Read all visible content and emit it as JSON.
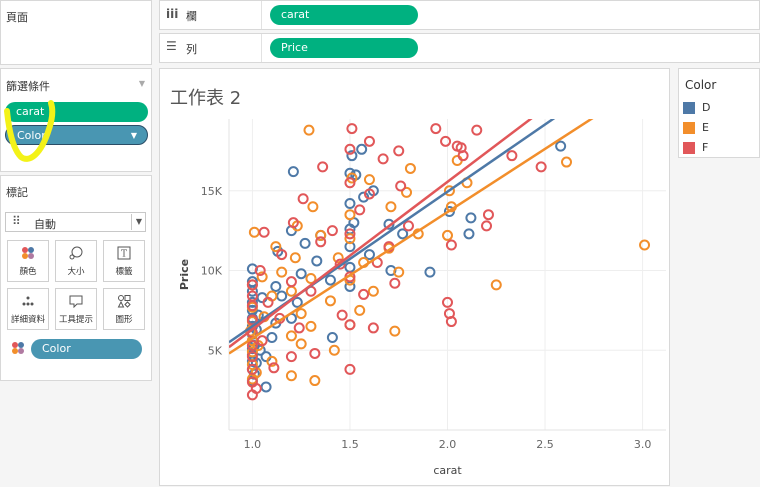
{
  "pages": {
    "title": "頁面"
  },
  "shelves": {
    "columns": {
      "icon": "iii",
      "label": "欄",
      "pill": "carat"
    },
    "rows": {
      "icon": "☰",
      "label": "列",
      "pill": "Price"
    }
  },
  "filters": {
    "title": "篩選條件",
    "items": [
      "carat",
      "Color"
    ]
  },
  "marks": {
    "title": "標記",
    "mark_type": "自動",
    "buttons": [
      {
        "label": "顏色",
        "icon": "color-icon"
      },
      {
        "label": "大小",
        "icon": "size-icon"
      },
      {
        "label": "標籤",
        "icon": "label-icon"
      },
      {
        "label": "詳細資料",
        "icon": "detail-icon"
      },
      {
        "label": "工具提示",
        "icon": "tooltip-icon"
      },
      {
        "label": "圖形",
        "icon": "shape-icon"
      }
    ],
    "color_pill": "Color"
  },
  "sheet": {
    "title": "工作表 2"
  },
  "legend": {
    "title": "Color",
    "items": [
      {
        "label": "D",
        "color": "#4e79a7"
      },
      {
        "label": "E",
        "color": "#f28e2b"
      },
      {
        "label": "F",
        "color": "#e15759"
      }
    ]
  },
  "chart_data": {
    "type": "scatter",
    "title": "",
    "xlabel": "carat",
    "ylabel": "Price",
    "xlim": [
      0.88,
      3.12
    ],
    "ylim": [
      0,
      19500
    ],
    "x_ticks": [
      "1.0",
      "1.5",
      "2.0",
      "2.5",
      "3.0"
    ],
    "y_ticks": [
      "5K",
      "10K",
      "15K"
    ],
    "grid": true,
    "legend_position": "right",
    "marker": "hollow-circle",
    "series": [
      {
        "name": "D",
        "color": "#4e79a7",
        "points": [
          [
            1.0,
            3100
          ],
          [
            1.0,
            3800
          ],
          [
            1.0,
            4300
          ],
          [
            1.0,
            4700
          ],
          [
            1.0,
            5100
          ],
          [
            1.0,
            5600
          ],
          [
            1.0,
            6000
          ],
          [
            1.0,
            6500
          ],
          [
            1.0,
            7000
          ],
          [
            1.0,
            7500
          ],
          [
            1.0,
            8000
          ],
          [
            1.0,
            8700
          ],
          [
            1.0,
            9300
          ],
          [
            1.0,
            10100
          ],
          [
            1.01,
            3500
          ],
          [
            1.01,
            5300
          ],
          [
            1.02,
            4200
          ],
          [
            1.02,
            6300
          ],
          [
            1.03,
            7200
          ],
          [
            1.04,
            5000
          ],
          [
            1.05,
            8300
          ],
          [
            1.07,
            4600
          ],
          [
            1.07,
            2700
          ],
          [
            1.1,
            5800
          ],
          [
            1.12,
            6700
          ],
          [
            1.12,
            9000
          ],
          [
            1.13,
            11200
          ],
          [
            1.15,
            8400
          ],
          [
            1.2,
            7000
          ],
          [
            1.2,
            12500
          ],
          [
            1.21,
            16200
          ],
          [
            1.23,
            8000
          ],
          [
            1.25,
            9800
          ],
          [
            1.27,
            11700
          ],
          [
            1.33,
            10600
          ],
          [
            1.35,
            12200
          ],
          [
            1.4,
            9400
          ],
          [
            1.41,
            5800
          ],
          [
            1.5,
            9000
          ],
          [
            1.5,
            10200
          ],
          [
            1.5,
            11500
          ],
          [
            1.5,
            12600
          ],
          [
            1.5,
            14200
          ],
          [
            1.5,
            16100
          ],
          [
            1.51,
            17200
          ],
          [
            1.52,
            13000
          ],
          [
            1.53,
            16000
          ],
          [
            1.56,
            17600
          ],
          [
            1.57,
            14600
          ],
          [
            1.6,
            11000
          ],
          [
            1.62,
            15000
          ],
          [
            1.7,
            12900
          ],
          [
            1.71,
            10000
          ],
          [
            1.77,
            12300
          ],
          [
            1.91,
            9900
          ],
          [
            2.01,
            13700
          ],
          [
            2.11,
            12300
          ],
          [
            2.12,
            13300
          ],
          [
            2.58,
            17800
          ]
        ]
      },
      {
        "name": "E",
        "color": "#f28e2b",
        "points": [
          [
            0.99,
            6200
          ],
          [
            1.0,
            3200
          ],
          [
            1.0,
            4100
          ],
          [
            1.0,
            4900
          ],
          [
            1.0,
            5600
          ],
          [
            1.0,
            6800
          ],
          [
            1.0,
            7700
          ],
          [
            1.0,
            9100
          ],
          [
            1.01,
            12400
          ],
          [
            1.02,
            3600
          ],
          [
            1.03,
            5300
          ],
          [
            1.05,
            9600
          ],
          [
            1.06,
            7100
          ],
          [
            1.1,
            4300
          ],
          [
            1.1,
            8400
          ],
          [
            1.12,
            11500
          ],
          [
            1.15,
            9900
          ],
          [
            1.2,
            3400
          ],
          [
            1.2,
            5900
          ],
          [
            1.2,
            8700
          ],
          [
            1.22,
            10800
          ],
          [
            1.23,
            12800
          ],
          [
            1.25,
            7300
          ],
          [
            1.25,
            5400
          ],
          [
            1.3,
            6500
          ],
          [
            1.3,
            9500
          ],
          [
            1.31,
            14000
          ],
          [
            1.35,
            12200
          ],
          [
            1.4,
            8100
          ],
          [
            1.42,
            5000
          ],
          [
            1.44,
            10800
          ],
          [
            1.5,
            6600
          ],
          [
            1.5,
            9400
          ],
          [
            1.5,
            12000
          ],
          [
            1.5,
            13500
          ],
          [
            1.51,
            15800
          ],
          [
            1.55,
            7500
          ],
          [
            1.57,
            10500
          ],
          [
            1.6,
            15700
          ],
          [
            1.62,
            8700
          ],
          [
            1.7,
            11400
          ],
          [
            1.71,
            14000
          ],
          [
            1.73,
            6200
          ],
          [
            1.75,
            9900
          ],
          [
            1.79,
            14900
          ],
          [
            1.81,
            16400
          ],
          [
            1.85,
            12300
          ],
          [
            2.0,
            12200
          ],
          [
            2.01,
            15000
          ],
          [
            2.02,
            14000
          ],
          [
            2.05,
            16900
          ],
          [
            2.1,
            15500
          ],
          [
            2.25,
            9100
          ],
          [
            2.61,
            16800
          ],
          [
            3.01,
            11600
          ],
          [
            1.29,
            18800
          ],
          [
            1.32,
            3100
          ]
        ]
      },
      {
        "name": "F",
        "color": "#e15759",
        "points": [
          [
            1.0,
            2200
          ],
          [
            1.0,
            3000
          ],
          [
            1.0,
            3800
          ],
          [
            1.0,
            4600
          ],
          [
            1.0,
            5300
          ],
          [
            1.0,
            6100
          ],
          [
            1.0,
            6900
          ],
          [
            1.0,
            7800
          ],
          [
            1.0,
            8400
          ],
          [
            1.0,
            9100
          ],
          [
            1.02,
            2600
          ],
          [
            1.04,
            10000
          ],
          [
            1.05,
            5600
          ],
          [
            1.06,
            12400
          ],
          [
            1.08,
            8000
          ],
          [
            1.11,
            3900
          ],
          [
            1.14,
            7000
          ],
          [
            1.15,
            11000
          ],
          [
            1.2,
            4600
          ],
          [
            1.2,
            9300
          ],
          [
            1.21,
            13000
          ],
          [
            1.24,
            6400
          ],
          [
            1.26,
            14500
          ],
          [
            1.3,
            8700
          ],
          [
            1.32,
            4800
          ],
          [
            1.35,
            11800
          ],
          [
            1.36,
            16500
          ],
          [
            1.41,
            12500
          ],
          [
            1.45,
            10400
          ],
          [
            1.46,
            7200
          ],
          [
            1.5,
            3800
          ],
          [
            1.5,
            6600
          ],
          [
            1.5,
            9600
          ],
          [
            1.5,
            12300
          ],
          [
            1.5,
            15500
          ],
          [
            1.5,
            17600
          ],
          [
            1.51,
            18900
          ],
          [
            1.55,
            13800
          ],
          [
            1.57,
            8500
          ],
          [
            1.6,
            14800
          ],
          [
            1.6,
            18100
          ],
          [
            1.62,
            6400
          ],
          [
            1.64,
            10500
          ],
          [
            1.67,
            17000
          ],
          [
            1.7,
            11500
          ],
          [
            1.73,
            9200
          ],
          [
            1.75,
            17500
          ],
          [
            1.76,
            15300
          ],
          [
            1.8,
            12800
          ],
          [
            2.0,
            8000
          ],
          [
            2.01,
            7300
          ],
          [
            2.02,
            6800
          ],
          [
            2.02,
            11600
          ],
          [
            2.05,
            17800
          ],
          [
            2.08,
            17200
          ],
          [
            2.15,
            18800
          ],
          [
            2.2,
            12800
          ],
          [
            2.21,
            13500
          ],
          [
            2.33,
            17200
          ],
          [
            2.48,
            16500
          ],
          [
            1.94,
            18900
          ],
          [
            1.99,
            18100
          ],
          [
            2.07,
            17700
          ]
        ]
      }
    ],
    "trend_lines": [
      {
        "series": "D",
        "from": [
          0.88,
          5500
        ],
        "to": [
          2.6,
          20000
        ]
      },
      {
        "series": "E",
        "from": [
          0.88,
          4800
        ],
        "to": [
          2.8,
          20000
        ]
      },
      {
        "series": "F",
        "from": [
          0.88,
          5200
        ],
        "to": [
          2.48,
          20000
        ]
      }
    ]
  }
}
